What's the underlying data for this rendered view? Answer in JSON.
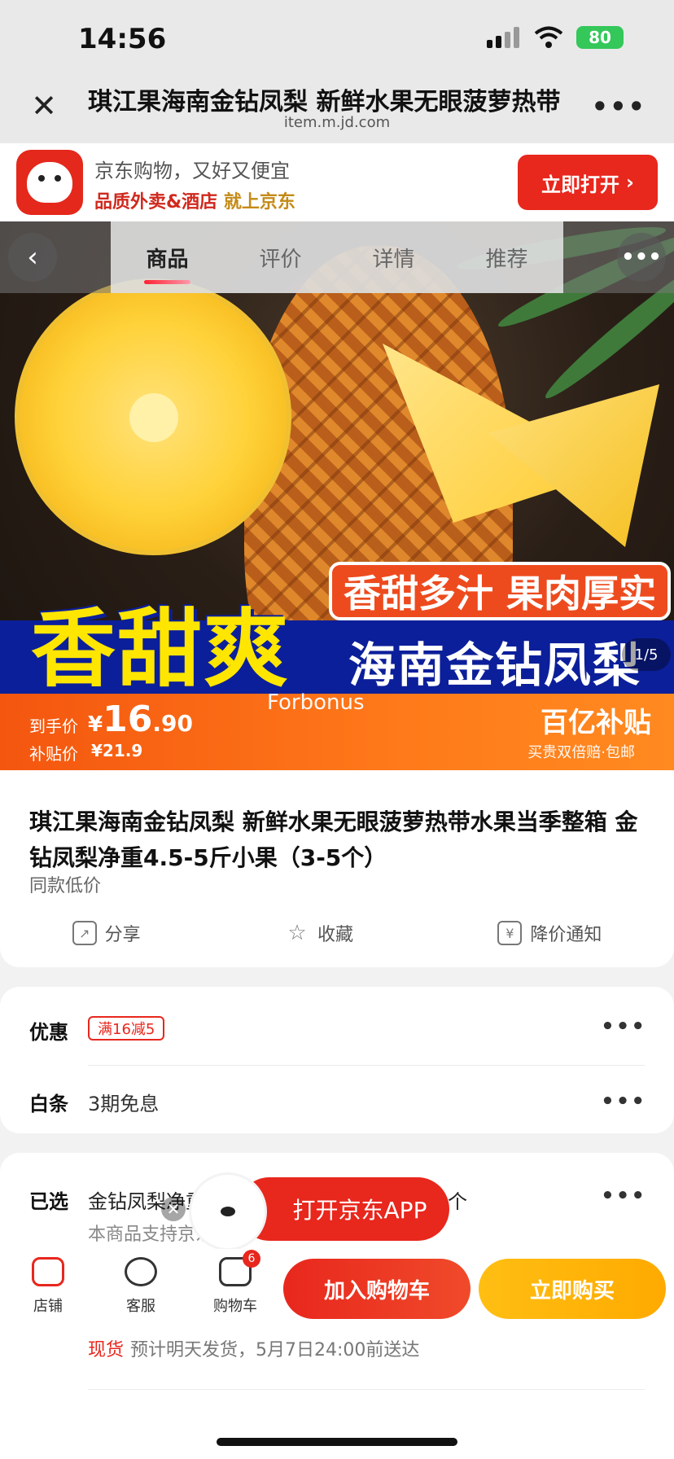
{
  "status_bar": {
    "time": "14:56",
    "battery": "80"
  },
  "browser": {
    "title": "琪江果海南金钻凤梨 新鲜水果无眼菠萝热带",
    "url": "item.m.jd.com",
    "more": "•••"
  },
  "app_banner": {
    "slogan": "京东购物，又好又便宜",
    "promo_a": "品质外卖&酒店",
    "promo_b": "就上京东",
    "open_button": "立即打开"
  },
  "product_tabs": [
    {
      "label": "商品",
      "active": true
    },
    {
      "label": "评价",
      "active": false
    },
    {
      "label": "详情",
      "active": false
    },
    {
      "label": "推荐",
      "active": false
    }
  ],
  "hero": {
    "tagline": "香甜多汁 果肉厚实",
    "big_text": "香甜爽",
    "blue_text": "海南金钻凤梨",
    "counter": "1/5",
    "watermark": "Forbonus"
  },
  "price": {
    "label": "到手价",
    "currency": "¥",
    "integer": "16",
    "decimal": ".90",
    "subsidy_label": "补贴价",
    "subsidy_price": "¥21.9",
    "bonus_title": "百亿补贴",
    "bonus_sub": "买贵双倍赔·包邮"
  },
  "product": {
    "title": "琪江果海南金钻凤梨 新鲜水果无眼菠萝热带水果当季整箱 金钻凤梨净重4.5-5斤小果（3-5个）",
    "same_low": "同款低价",
    "actions": [
      "分享",
      "收藏",
      "降价通知"
    ]
  },
  "promo": {
    "label": "优惠",
    "coupon": "满16减5",
    "installment_label": "白条",
    "installment": "3期免息",
    "dots": "•••"
  },
  "selection": {
    "label": "已选",
    "value": "金钻凤梨净重",
    "count": "个",
    "support": "本商品支持京东",
    "stock": "现货",
    "shipping": "预计明天发货，5月7日24:00前送达"
  },
  "float": {
    "label": "打开京东APP"
  },
  "bottom_bar": {
    "store": "店铺",
    "service": "客服",
    "cart": "购物车",
    "cart_count": "6",
    "add_cart": "加入购物车",
    "buy_now": "立即购买"
  },
  "colors": {
    "brand_red": "#e8271d",
    "buy_yellow": "#ffb400",
    "price_orange": "#f4560f",
    "band_blue": "#0c1f9a"
  },
  "icons": [
    "close-icon",
    "wifi-icon",
    "signal-icon",
    "battery-icon",
    "back-icon",
    "share-icon",
    "star-icon",
    "price-alert-icon",
    "store-icon",
    "service-icon",
    "cart-icon"
  ]
}
